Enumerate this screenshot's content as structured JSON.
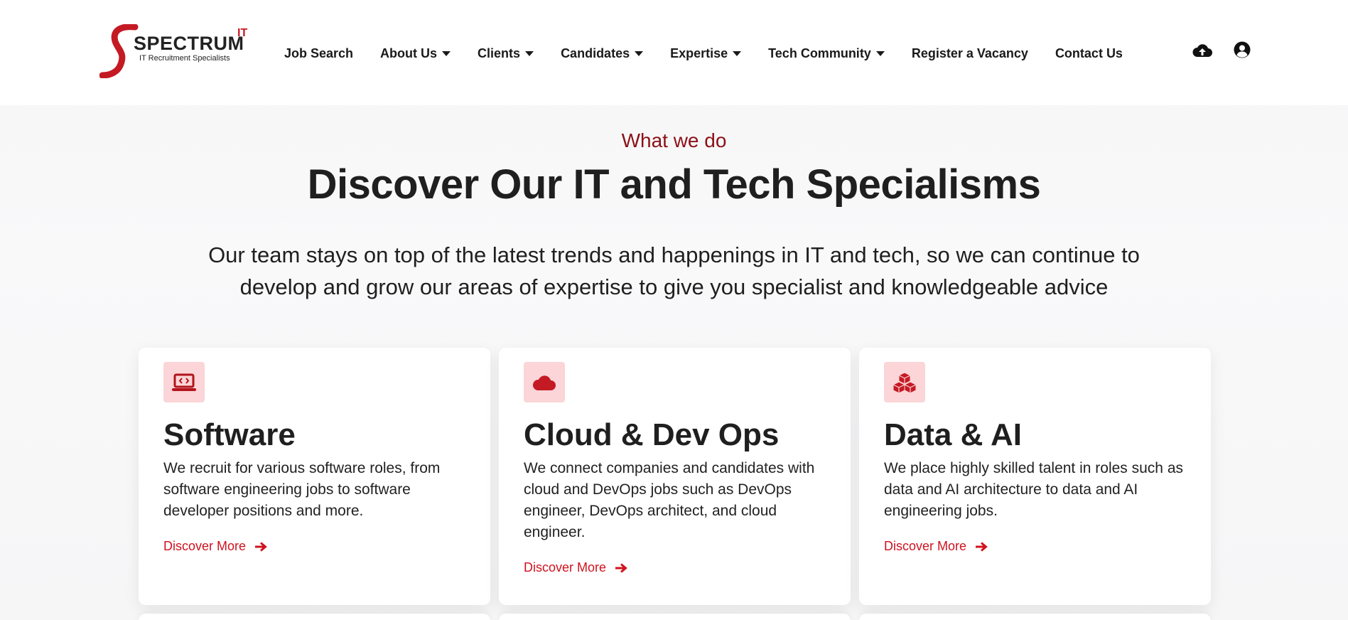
{
  "header": {
    "logo": {
      "brand": "SPECTRUM",
      "superscript": "IT",
      "tagline": "IT Recruitment Specialists"
    },
    "nav": [
      {
        "label": "Job Search",
        "dropdown": false
      },
      {
        "label": "About Us",
        "dropdown": true
      },
      {
        "label": "Clients",
        "dropdown": true
      },
      {
        "label": "Candidates",
        "dropdown": true
      },
      {
        "label": "Expertise",
        "dropdown": true
      },
      {
        "label": "Tech Community",
        "dropdown": true
      },
      {
        "label": "Register a Vacancy",
        "dropdown": false
      },
      {
        "label": "Contact Us",
        "dropdown": false
      }
    ],
    "icons": [
      "cloud-upload-icon",
      "user-account-icon"
    ]
  },
  "intro": {
    "eyebrow": "What we do",
    "title": "Discover Our IT and Tech Specialisms",
    "line1": "Our team stays on top of the latest trends and happenings in IT and tech, so we can continue to",
    "line2": "develop and grow our areas of expertise to give you specialist and knowledgeable advice"
  },
  "cards": [
    {
      "icon": "laptop-code-icon",
      "title": "Software",
      "desc": "We recruit for various software roles, from software engineering jobs to software developer positions and more.",
      "link": "Discover More"
    },
    {
      "icon": "cloud-icon",
      "title": "Cloud & Dev Ops",
      "desc": "We connect companies and candidates with cloud and DevOps jobs such as DevOps engineer, DevOps architect, and cloud engineer.",
      "link": "Discover More"
    },
    {
      "icon": "cubes-icon",
      "title": "Data & AI",
      "desc": "We place highly skilled talent in roles such as data and AI architecture to data and AI engineering jobs.",
      "link": "Discover More"
    }
  ],
  "colors": {
    "accent": "#d0121e",
    "eyebrow": "#8b1116",
    "icon_bg": "#fbd5d7",
    "text": "#1f1f1f"
  }
}
